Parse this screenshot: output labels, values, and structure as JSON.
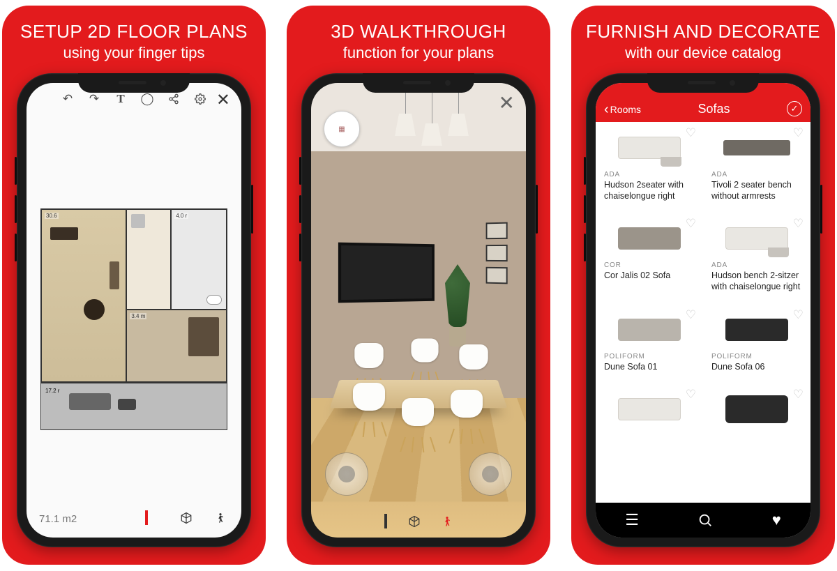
{
  "cards": [
    {
      "title": "SETUP 2D FLOOR PLANS",
      "sub": "using your finger tips"
    },
    {
      "title": "3D WALKTHROUGH",
      "sub": "function for your plans"
    },
    {
      "title": "FURNISH AND DECORATE",
      "sub": "with our device catalog"
    }
  ],
  "screen1": {
    "area": "71.1 m2",
    "rooms": {
      "living": "30.6",
      "kitchen": "",
      "bath": "4.0 r",
      "bed": "3.4 m",
      "lower": "17.2 r"
    }
  },
  "screen3": {
    "back": "Rooms",
    "title": "Sofas",
    "items": [
      {
        "brand": "ADA",
        "name": "Hudson 2seater with chaiselongue right"
      },
      {
        "brand": "ADA",
        "name": "Tivoli 2 seater bench without armrests"
      },
      {
        "brand": "Cor",
        "name": "Cor Jalis 02 Sofa"
      },
      {
        "brand": "ADA",
        "name": "Hudson bench 2-sitzer with chaiselongue right"
      },
      {
        "brand": "Poliform",
        "name": "Dune Sofa 01"
      },
      {
        "brand": "Poliform",
        "name": "Dune Sofa 06"
      }
    ]
  }
}
